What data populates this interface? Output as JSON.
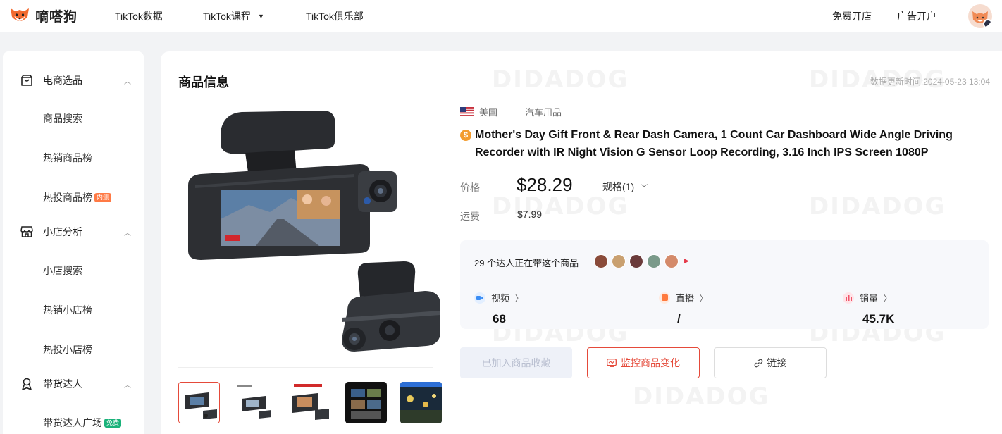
{
  "header": {
    "brand": "嘀嗒狗",
    "nav": [
      "TikTok数据",
      "TikTok课程",
      "TikTok俱乐部"
    ],
    "right_links": [
      "免费开店",
      "广告开户"
    ]
  },
  "sidebar": {
    "groups": [
      {
        "label": "电商选品",
        "items": [
          {
            "label": "商品搜索",
            "tag": ""
          },
          {
            "label": "热销商品榜",
            "tag": ""
          },
          {
            "label": "热投商品榜",
            "tag": "内测"
          }
        ]
      },
      {
        "label": "小店分析",
        "items": [
          {
            "label": "小店搜索",
            "tag": ""
          },
          {
            "label": "热销小店榜",
            "tag": ""
          },
          {
            "label": "热投小店榜",
            "tag": ""
          }
        ]
      },
      {
        "label": "带货达人",
        "items": [
          {
            "label": "带货达人广场",
            "tag": "免费"
          }
        ]
      }
    ]
  },
  "main": {
    "watermark": "DIDADOG",
    "section_title": "商品信息",
    "update_time": "数据更新时间:2024-05-23 13:04",
    "product": {
      "country": "美国",
      "category": "汽车用品",
      "title": "Mother's Day Gift Front & Rear Dash Camera, 1 Count Car Dashboard Wide Angle Driving Recorder with IR Night Vision G Sensor Loop Recording, 3.16 Inch IPS Screen 1080P",
      "price_label": "价格",
      "price": "$28.29",
      "spec": "规格(1)",
      "shipping_label": "运费",
      "shipping": "$7.99"
    },
    "creators_text": "29 个达人正在带这个商品",
    "stats": [
      {
        "label": "视频",
        "value": "68",
        "color": "#3a8df5"
      },
      {
        "label": "直播",
        "value": "/",
        "color": "#ff7a3d"
      },
      {
        "label": "销量",
        "value": "45.7K",
        "color": "#f0556a"
      }
    ],
    "buttons": {
      "favorite": "已加入商品收藏",
      "monitor": "监控商品变化",
      "link": "链接"
    }
  },
  "colors": {
    "accent": "#e54a3a",
    "brand": "#ff6a2a"
  }
}
